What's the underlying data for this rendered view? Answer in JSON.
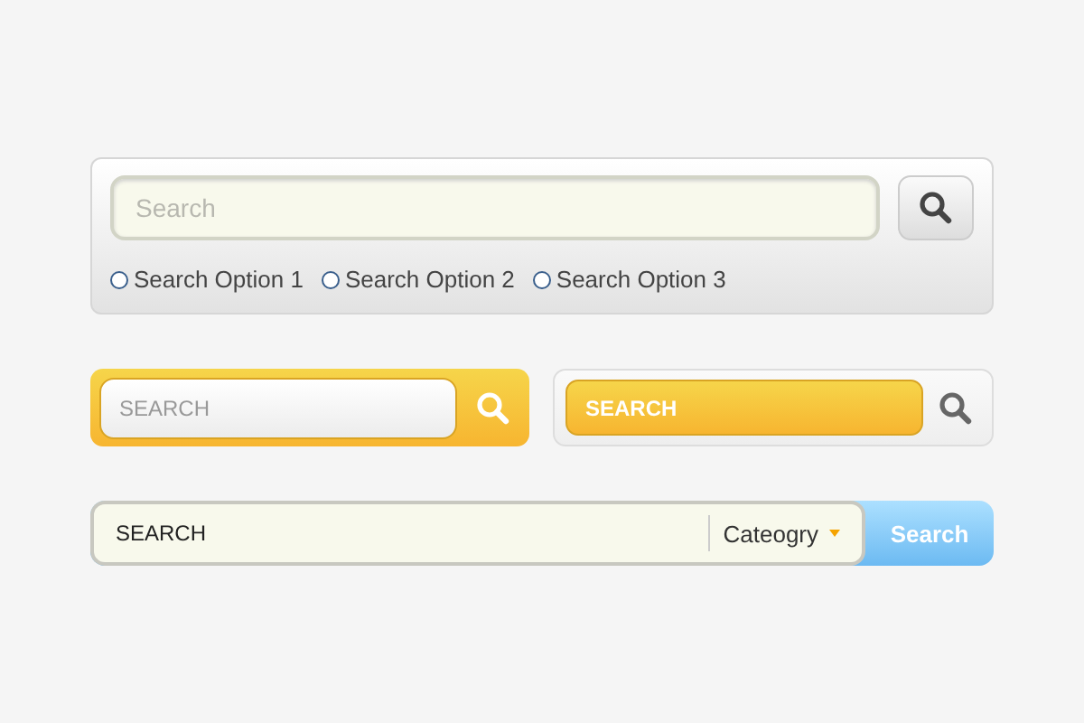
{
  "search_panel": {
    "field": {
      "placeholder": "Search"
    },
    "options": [
      {
        "label": "Search Option 1",
        "selected": false
      },
      {
        "label": "Search Option 2",
        "selected": false
      },
      {
        "label": "Search Option 3",
        "selected": false
      }
    ]
  },
  "yellow_search": {
    "field": {
      "placeholder": "SEARCH"
    }
  },
  "gray_search": {
    "field": {
      "placeholder": "SEARCH"
    }
  },
  "category_search": {
    "field": {
      "value": "SEARCH"
    },
    "category": "Cateogry",
    "button": "Search"
  }
}
